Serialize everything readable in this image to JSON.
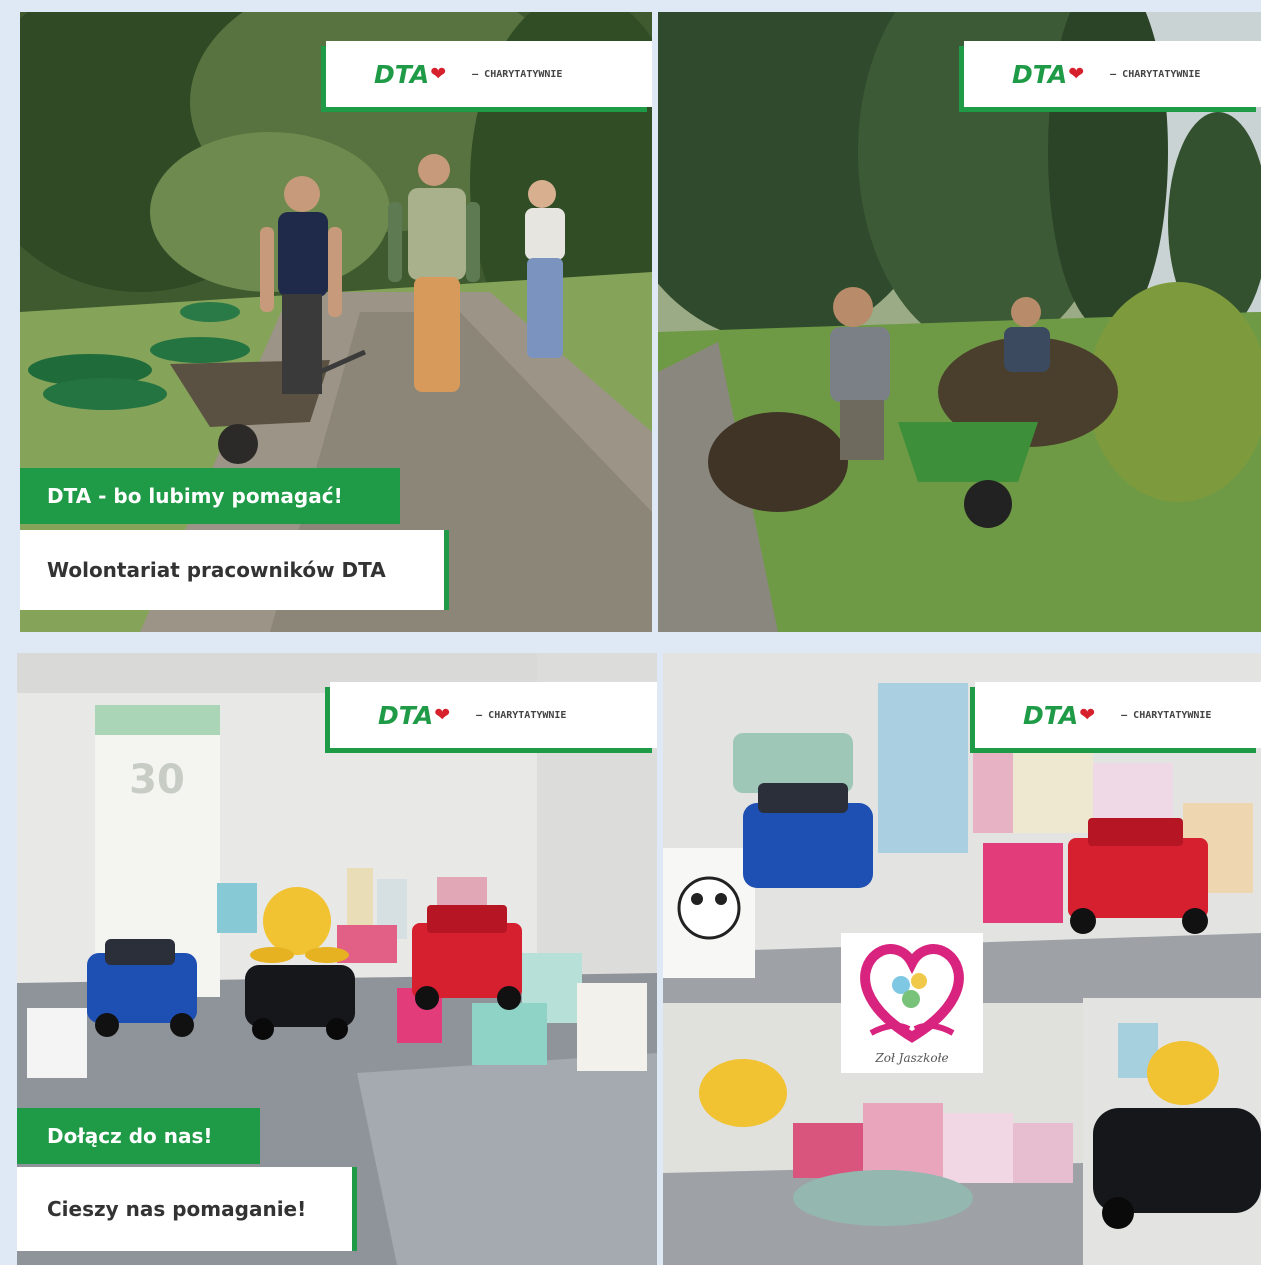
{
  "logo": {
    "brand": "DTA",
    "tagline": "— CHARYTATYWNIE"
  },
  "tiles": {
    "tile1": {
      "headline": "DTA - bo lubimy pomagać!",
      "subheadline": "Wolontariat pracowników DTA"
    },
    "tile3": {
      "headline": "Dołącz do nas!",
      "subheadline": "Cieszy nas pomaganie!"
    },
    "tile4": {
      "badge_text": "Zoł Jaszkołe"
    }
  },
  "colors": {
    "brand_green": "#1f9a47",
    "heart_red": "#d6212d"
  }
}
